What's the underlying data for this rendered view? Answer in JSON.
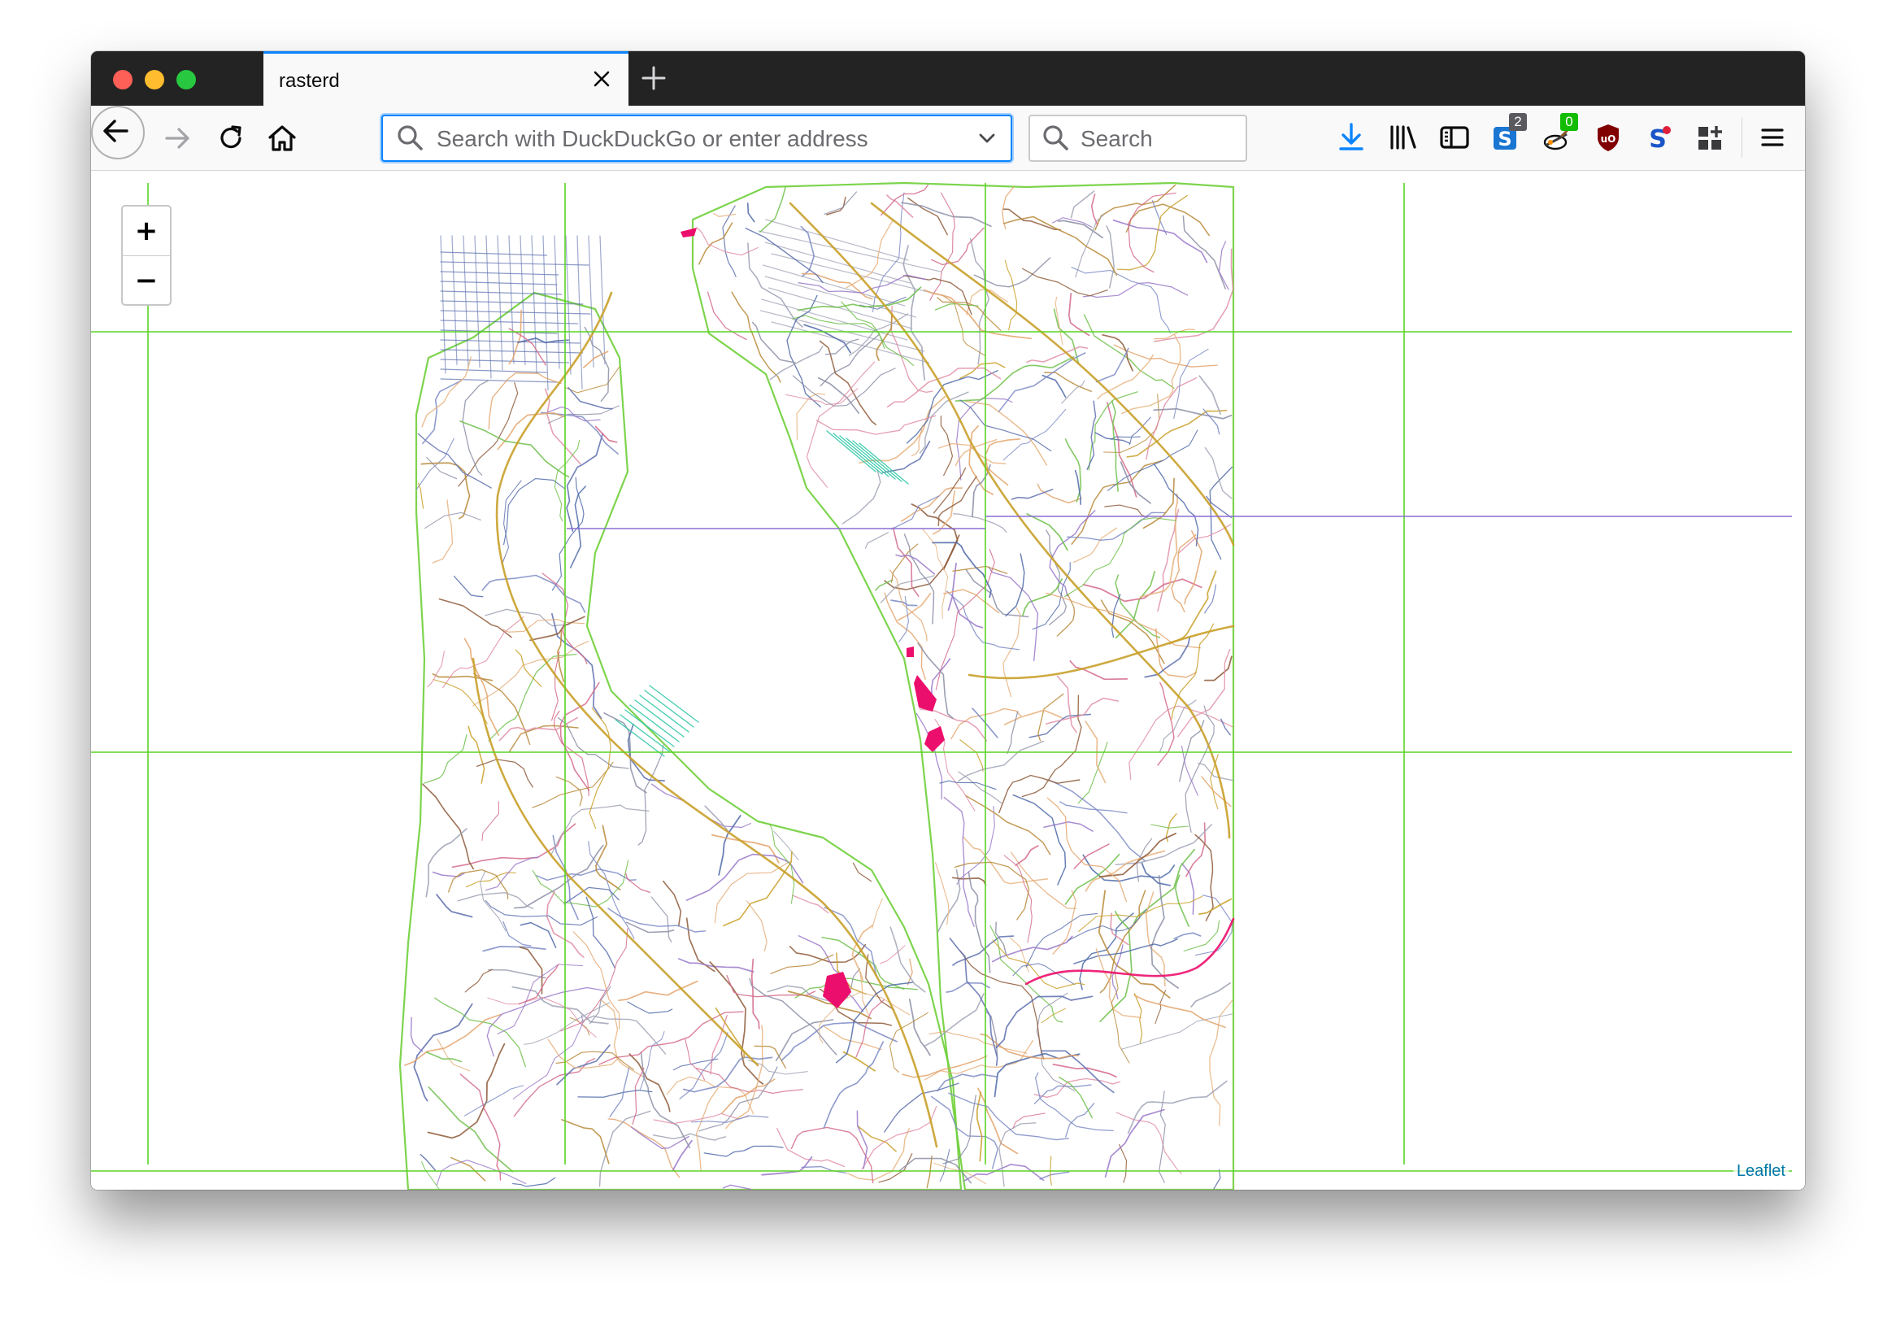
{
  "window": {
    "tab_title": "rasterd"
  },
  "navbar": {
    "urlbar_placeholder": "Search with DuckDuckGo or enter address",
    "searchbar_placeholder": "Search",
    "badges": {
      "stylus_count": "2",
      "tampermonkey_count": "0"
    }
  },
  "map": {
    "zoom_in_label": "+",
    "zoom_out_label": "−",
    "attribution": "Leaflet"
  },
  "colors": {
    "accent": "#0a84ff",
    "download_icon": "#0a84ff",
    "grid_green": "#5ad425",
    "grid_purple": "#8b6fd6",
    "highlight_magenta": "#ec0e6c",
    "attribution_link": "#0078a8"
  },
  "icons": [
    "back-arrow-icon",
    "forward-arrow-icon",
    "reload-icon",
    "home-icon",
    "search-icon",
    "dropdown-chevron-icon",
    "download-icon",
    "library-icon",
    "sidebar-icon",
    "stylus-icon",
    "tampermonkey-icon",
    "ublock-icon",
    "extension-s-icon",
    "extensions-grid-icon",
    "menu-icon"
  ]
}
